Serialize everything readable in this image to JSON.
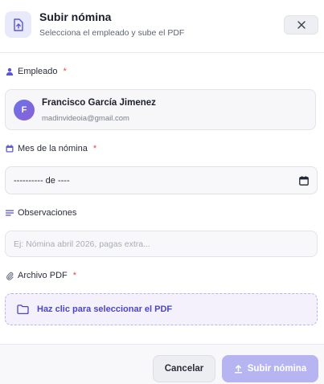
{
  "header": {
    "icon": "upload-file-icon",
    "title": "Subir nómina",
    "subtitle": "Selecciona el empleado y sube el PDF",
    "close_icon": "close-icon"
  },
  "employee": {
    "label": "Empleado",
    "required_mark": "*",
    "icon": "user-icon",
    "avatar_initial": "F",
    "name": "Francisco García Jimenez",
    "email": "madinvideoia@gmail.com"
  },
  "month": {
    "label": "Mes de la nómina",
    "required_mark": "*",
    "icon": "calendar-icon",
    "value": "---------- de ----"
  },
  "notes": {
    "label": "Observaciones",
    "icon": "lines-icon",
    "value": "",
    "placeholder": "Ej: Nómina abril 2026, pagas extra..."
  },
  "pdf": {
    "label": "Archivo PDF",
    "required_mark": "*",
    "icon": "paperclip-icon",
    "dropzone_text": "Haz clic para seleccionar el PDF",
    "dropzone_icon": "folder-icon"
  },
  "footer": {
    "cancel_label": "Cancelar",
    "submit_label": "Subir nómina",
    "submit_icon": "upload-icon"
  },
  "colors": {
    "accent": "#4b45c6",
    "submit_disabled": "#b6b5f2",
    "required": "#e5484d"
  }
}
